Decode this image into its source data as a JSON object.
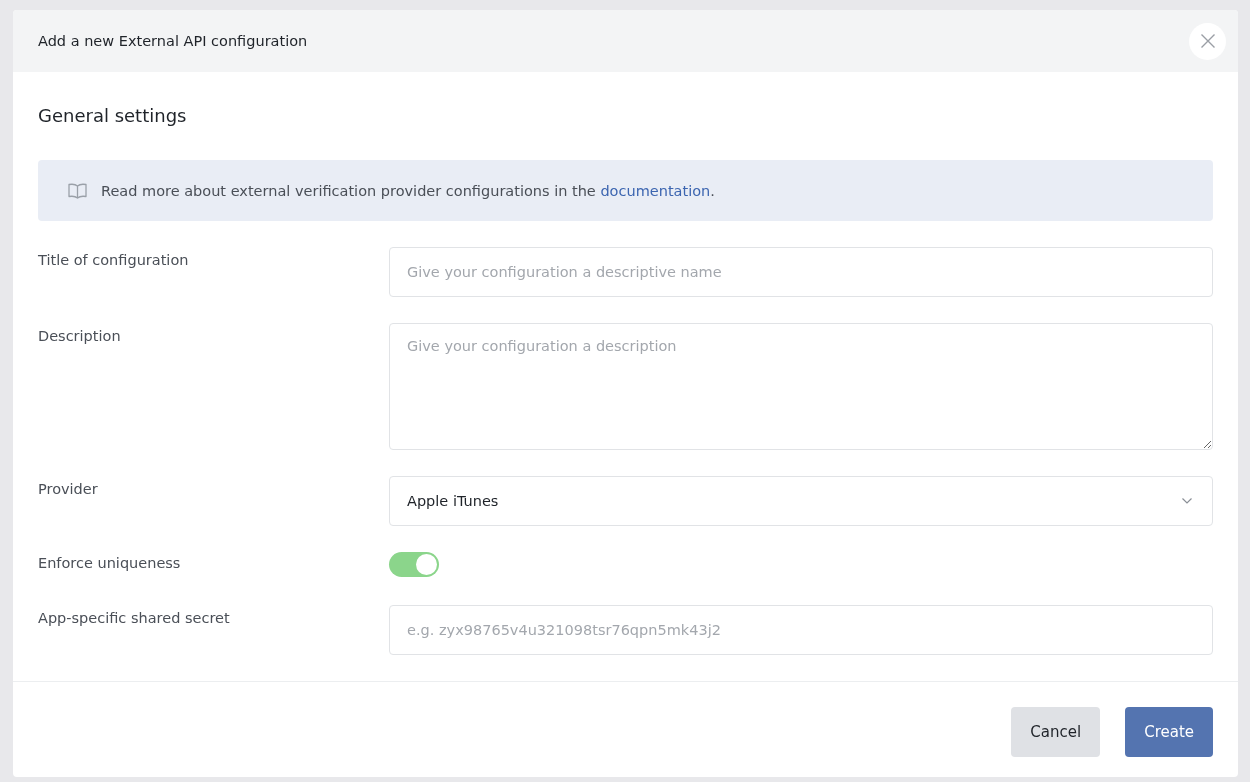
{
  "dialog": {
    "title": "Add a new External API configuration"
  },
  "section_title": "General settings",
  "info_banner": {
    "text": "Read more about external verification provider configurations in the ",
    "link": "documentation",
    "suffix": "."
  },
  "fields": [
    {
      "kind": "text",
      "label": "Title of configuration",
      "placeholder": "Give your configuration a descriptive name"
    },
    {
      "kind": "textarea",
      "label": "Description",
      "placeholder": "Give your configuration a description"
    },
    {
      "kind": "select",
      "label": "Provider",
      "value": "Apple iTunes"
    },
    {
      "kind": "toggle",
      "label": "Enforce uniqueness",
      "on": true
    },
    {
      "kind": "text",
      "label": "App-specific shared secret",
      "placeholder": "e.g. zyx98765v4u321098tsr76qpn5mk43j2"
    }
  ],
  "buttons": [
    {
      "label": "Cancel",
      "kind": "secondary"
    },
    {
      "label": "Create",
      "kind": "primary"
    }
  ]
}
